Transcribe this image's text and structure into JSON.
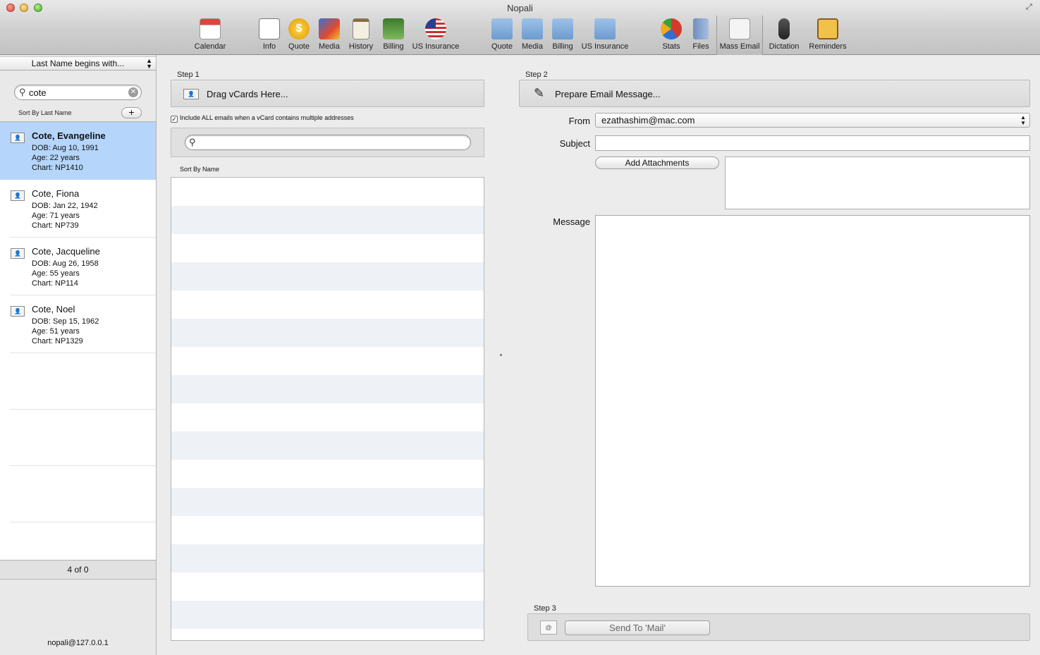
{
  "window": {
    "title": "Nopali"
  },
  "toolbar": {
    "items": [
      {
        "label": "Calendar",
        "icon": "calendar-icon"
      },
      {
        "label": "Info",
        "icon": "contact-card-icon"
      },
      {
        "label": "Quote",
        "icon": "coin-icon"
      },
      {
        "label": "Media",
        "icon": "media-icon"
      },
      {
        "label": "History",
        "icon": "clipboard-icon"
      },
      {
        "label": "Billing",
        "icon": "money-stack-icon"
      },
      {
        "label": "US Insurance",
        "icon": "us-flag-icon"
      },
      {
        "label": "Quote",
        "icon": "quote-folder-icon"
      },
      {
        "label": "Media",
        "icon": "media-folder-icon"
      },
      {
        "label": "Billing",
        "icon": "billing-folder-icon"
      },
      {
        "label": "US Insurance",
        "icon": "insurance-folder-icon"
      },
      {
        "label": "Stats",
        "icon": "pie-chart-icon"
      },
      {
        "label": "Files",
        "icon": "file-cabinet-icon"
      },
      {
        "label": "Mass Email",
        "icon": "mail-envelope-icon"
      },
      {
        "label": "Dictation",
        "icon": "microphone-icon"
      },
      {
        "label": "Reminders",
        "icon": "corkboard-icon"
      }
    ],
    "active": "Mass Email"
  },
  "sidebar": {
    "filter": "Last Name begins with...",
    "search_value": "cote",
    "sort_label": "Sort By Last Name",
    "add_symbol": "+",
    "patients": [
      {
        "name": "Cote, Evangeline",
        "dob": "DOB: Aug 10, 1991",
        "age": "Age: 22 years",
        "chart": "Chart: NP1410",
        "selected": true
      },
      {
        "name": "Cote, Fiona",
        "dob": "DOB: Jan 22, 1942",
        "age": "Age: 71 years",
        "chart": "Chart: NP739",
        "selected": false
      },
      {
        "name": "Cote, Jacqueline",
        "dob": "DOB: Aug 26, 1958",
        "age": "Age: 55 years",
        "chart": "Chart: NP114",
        "selected": false
      },
      {
        "name": "Cote, Noel",
        "dob": "DOB: Sep 15, 1962",
        "age": "Age: 51 years",
        "chart": "Chart: NP1329",
        "selected": false
      }
    ],
    "count": "4 of 0",
    "user": "nopali@127.0.0.1"
  },
  "step1": {
    "label": "Step 1",
    "drag_text": "Drag vCards Here...",
    "include_all": "Include ALL emails when a vCard contains multiple addresses",
    "include_all_checked": true,
    "search_value": "",
    "sort_label": "Sort By Name"
  },
  "step2": {
    "label": "Step 2",
    "prepare_text": "Prepare Email Message...",
    "from_label": "From",
    "from_value": "ezathashim@mac.com",
    "subject_label": "Subject",
    "subject_value": "",
    "add_attachments": "Add Attachments",
    "message_label": "Message",
    "message_value": ""
  },
  "step3": {
    "label": "Step 3",
    "send_button": "Send To 'Mail'"
  },
  "colors": {
    "selection": "#b5d5fb",
    "stripe": "#eef1f6"
  }
}
